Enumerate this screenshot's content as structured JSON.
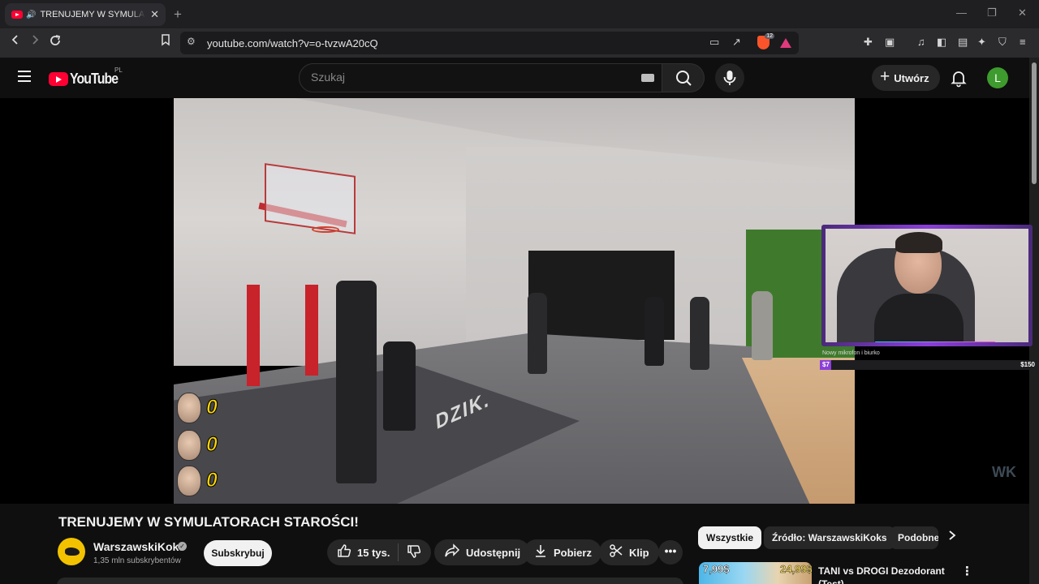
{
  "browser": {
    "tab_title": "TRENUJEMY W SYMULATORACH STAROŚCI!",
    "new_tab": "+",
    "url": "youtube.com/watch?v=o-tvzwA20cQ",
    "brave_badge": "12",
    "minimize": "—",
    "maximize": "❐",
    "close": "✕"
  },
  "youtube": {
    "logo_text": "YouTube",
    "country": "PL",
    "search_placeholder": "Szukaj",
    "create_label": "Utwórz",
    "avatar_letter": "L"
  },
  "video": {
    "floor_logo": "DZIK.",
    "scores": [
      "0",
      "0",
      "0"
    ],
    "watermark": "WK"
  },
  "webcam": {
    "goal_text": "Nowy mikrofon i biurko",
    "goal_current": "$7",
    "goal_target": "$150",
    "goal_progress": 0.047
  },
  "details": {
    "title": "TRENUJEMY W SYMULATORACH STAROŚCI!",
    "channel_name": "WarszawskiKoks",
    "subscribers": "1,35 mln subskrybentów",
    "subscribe_label": "Subskrybuj",
    "likes": "15 tys.",
    "share_label": "Udostępnij",
    "download_label": "Pobierz",
    "clip_label": "Klip",
    "more_label": "•••"
  },
  "sidebar": {
    "chips": [
      "Wszystkie",
      "Źródło: WarszawskiKoks",
      "Podobne"
    ],
    "rec_title": "TANI vs DROGI Dezodorant (Test)",
    "thumb_price_1": "7,99$",
    "thumb_price_2": "24,99$"
  }
}
